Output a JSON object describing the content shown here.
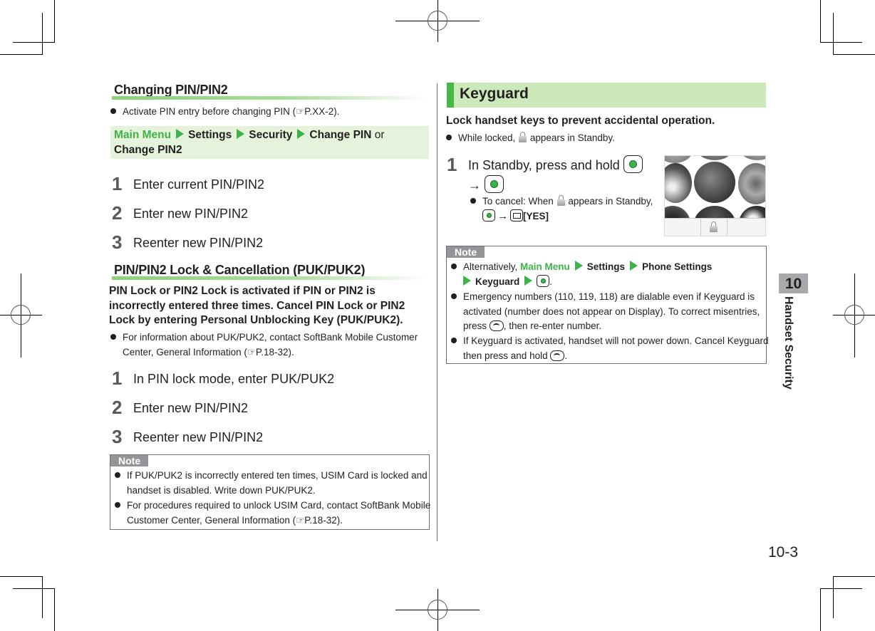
{
  "left": {
    "changing_pin": {
      "title": "Changing PIN/PIN2",
      "bullet": "Activate PIN entry before changing PIN (☞P.XX-2).",
      "menu_path": {
        "main_menu": "Main Menu",
        "settings": "Settings",
        "security": "Security",
        "change_pin": "Change PIN",
        "or": "or",
        "change_pin2": "Change PIN2"
      },
      "steps": [
        {
          "num": "1",
          "text": "Enter current PIN/PIN2"
        },
        {
          "num": "2",
          "text": "Enter new PIN/PIN2"
        },
        {
          "num": "3",
          "text": "Reenter new PIN/PIN2"
        }
      ]
    },
    "puk": {
      "title": "PIN/PIN2 Lock & Cancellation (PUK/PUK2)",
      "intro": "PIN Lock or PIN2 Lock is activated if PIN or PIN2 is incorrectly entered three times. Cancel PIN Lock or PIN2 Lock by entering Personal Unblocking Key (PUK/PUK2).",
      "bullet": "For information about PUK/PUK2, contact SoftBank Mobile Customer Center, General Information (☞P.18-32).",
      "steps": [
        {
          "num": "1",
          "text": "In PIN lock mode, enter PUK/PUK2"
        },
        {
          "num": "2",
          "text": "Enter new PIN/PIN2"
        },
        {
          "num": "3",
          "text": "Reenter new PIN/PIN2"
        }
      ],
      "note": {
        "label": "Note",
        "items": [
          "If PUK/PUK2 is incorrectly entered ten times, USIM Card is locked and handset is disabled. Write down PUK/PUK2.",
          "For procedures required to unlock USIM Card, contact SoftBank Mobile Customer Center, General Information (☞P.18-32)."
        ]
      }
    }
  },
  "right": {
    "keyguard": {
      "title": "Keyguard",
      "intro": "Lock handset keys to prevent accidental operation.",
      "bullet_pre": "While locked,",
      "bullet_post": "appears in Standby.",
      "step1": {
        "num": "1",
        "text": "In Standby, press and hold",
        "arrow": "→",
        "cancel_pre": "To cancel: When",
        "cancel_post": "appears in Standby,",
        "yes": "[YES]"
      },
      "note": {
        "label": "Note",
        "item1": {
          "pre": "Alternatively,",
          "main_menu": "Main Menu",
          "settings": "Settings",
          "phone_settings": "Phone Settings",
          "keyguard": "Keyguard",
          "end": "."
        },
        "item2_a": "Emergency numbers (110, 119, 118) are dialable even if Keyguard is activated (number does not appear on Display). To correct misentries, press",
        "item2_b": ", then re-enter number.",
        "item3_a": "If Keyguard is activated, handset will not power down. Cancel Keyguard then press and hold",
        "item3_b": "."
      }
    }
  },
  "side": {
    "chapter_num": "10",
    "chapter_label": "Handset Security"
  },
  "footer": {
    "page_number": "10-3"
  },
  "colors": {
    "accent_green": "#3db34a",
    "menu_bg": "#e6f3dc",
    "keyguard_header_bg": "#cbe9bb",
    "note_tab": "#939598",
    "chapter_tab": "#a7a9ac"
  }
}
